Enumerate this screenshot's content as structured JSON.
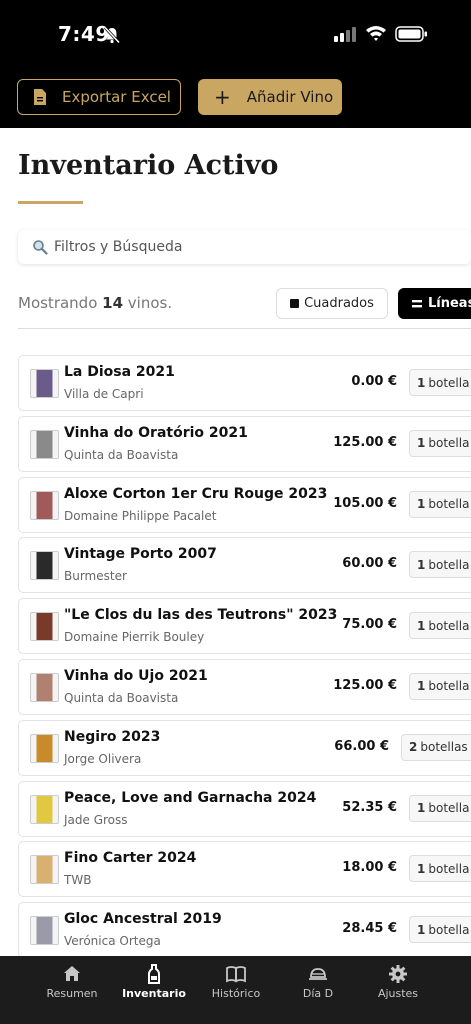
{
  "status_bar": {
    "time": "7:49"
  },
  "toolbar": {
    "export_label": "Exportar Excel",
    "add_label": "Añadir Vino"
  },
  "page": {
    "title": "Inventario Activo",
    "search_placeholder": "Filtros y Búsqueda",
    "showing_prefix": "Mostrando ",
    "showing_count": "14",
    "showing_suffix": " vinos.",
    "view_grid_label": "Cuadrados",
    "view_lines_label": "Líneas"
  },
  "wines": [
    {
      "name": "La Diosa 2021",
      "producer": "Villa de Capri",
      "price": "0.00 €",
      "qty": "1",
      "unit": "botella",
      "thumb_color": "#6b5b8a"
    },
    {
      "name": "Vinha do Oratório 2021",
      "producer": "Quinta da Boavista",
      "price": "125.00 €",
      "qty": "1",
      "unit": "botella",
      "thumb_color": "#8a8a8a"
    },
    {
      "name": "Aloxe Corton 1er Cru Rouge 2023",
      "producer": "Domaine Philippe Pacalet",
      "price": "105.00 €",
      "qty": "1",
      "unit": "botella",
      "thumb_color": "#a05a5a"
    },
    {
      "name": "Vintage Porto 2007",
      "producer": "Burmester",
      "price": "60.00 €",
      "qty": "1",
      "unit": "botella",
      "thumb_color": "#2a2a2a"
    },
    {
      "name": "\"Le Clos du las des Teutrons\" 2023",
      "producer": "Domaine Pierrik Bouley",
      "price": "75.00 €",
      "qty": "1",
      "unit": "botella",
      "thumb_color": "#7a3a2a"
    },
    {
      "name": "Vinha do Ujo 2021",
      "producer": "Quinta da Boavista",
      "price": "125.00 €",
      "qty": "1",
      "unit": "botella",
      "thumb_color": "#b08070"
    },
    {
      "name": "Negiro 2023",
      "producer": "Jorge Olivera",
      "price": "66.00 €",
      "qty": "2",
      "unit": "botellas",
      "thumb_color": "#c98a2a"
    },
    {
      "name": "Peace, Love and Garnacha 2024",
      "producer": "Jade Gross",
      "price": "52.35 €",
      "qty": "1",
      "unit": "botella",
      "thumb_color": "#e0c840"
    },
    {
      "name": "Fino Carter 2024",
      "producer": "TWB",
      "price": "18.00 €",
      "qty": "1",
      "unit": "botella",
      "thumb_color": "#d8b070"
    },
    {
      "name": "Gloc Ancestral 2019",
      "producer": "Verónica Ortega",
      "price": "28.45 €",
      "qty": "1",
      "unit": "botella",
      "thumb_color": "#9a9aa8"
    }
  ],
  "tabs": [
    {
      "label": "Resumen",
      "icon": "home-icon"
    },
    {
      "label": "Inventario",
      "icon": "bottle-icon"
    },
    {
      "label": "Histórico",
      "icon": "book-icon"
    },
    {
      "label": "Día D",
      "icon": "cloche-icon"
    },
    {
      "label": "Ajustes",
      "icon": "gear-icon"
    }
  ],
  "colors": {
    "accent": "#c9a763",
    "dark": "#000000",
    "tab_bar": "#1c1c1c"
  }
}
